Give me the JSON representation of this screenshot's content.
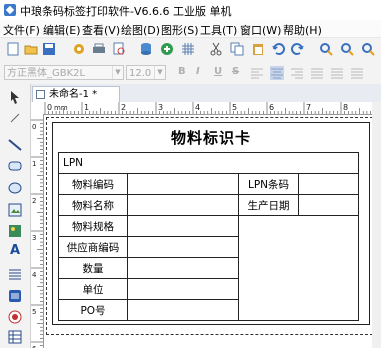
{
  "window": {
    "title": "中琅条码标签打印软件-V6.6.6 工业版 单机"
  },
  "menu": [
    "文件(F)",
    "编辑(E)",
    "查看(V)",
    "绘图(D)",
    "图形(S)",
    "工具(T)",
    "窗口(W)",
    "帮助(H)"
  ],
  "format_bar": {
    "font": "方正黑体_GBK2L",
    "size": "12.0",
    "bold": "B",
    "italic": "I",
    "underline": "U",
    "strike": "S"
  },
  "tab": {
    "label": "未命名-1 *"
  },
  "ruler": {
    "unit": "mm",
    "ticks": [
      "0",
      "1",
      "2",
      "3",
      "4",
      "5",
      "6",
      "7",
      "8",
      "9"
    ]
  },
  "label": {
    "title": "物料标识卡",
    "lpn": "LPN",
    "rows": [
      "物料编码",
      "物料名称",
      "物料规格",
      "供应商编码",
      "数量",
      "单位",
      "PO号"
    ],
    "right_fields": [
      "LPN条码",
      "生产日期"
    ]
  },
  "colors": {
    "accent": "#3a78c9",
    "toolbar_bg": "#f3f3f3"
  }
}
